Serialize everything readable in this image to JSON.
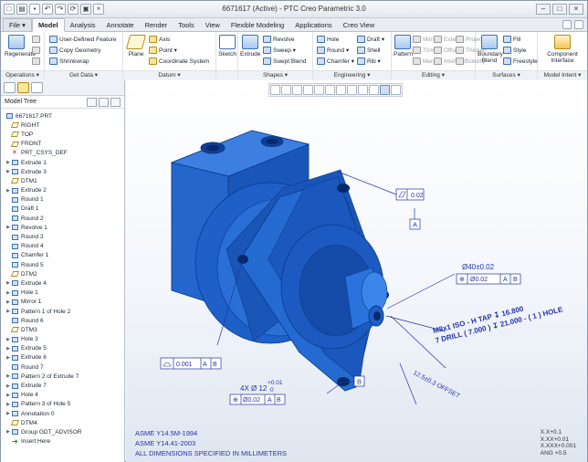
{
  "window": {
    "title": "6671617 (Active) - PTC Creo Parametric 3.0"
  },
  "tabs": [
    "File ▾",
    "Model",
    "Analysis",
    "Annotate",
    "Render",
    "Tools",
    "View",
    "Flexible Modeling",
    "Applications",
    "Creo View"
  ],
  "active_tab": "Model",
  "ribbon": {
    "operations": {
      "label": "Operations ▾",
      "regenerate": "Regenerate"
    },
    "get_data": {
      "label": "Get Data ▾",
      "udf": "User-Defined Feature",
      "copy_geometry": "Copy Geometry",
      "shrinkwrap": "Shrinkwrap"
    },
    "datum": {
      "label": "Datum ▾",
      "plane": "Plane",
      "axis": "Axis",
      "point": "Point ▾",
      "csys": "Coordinate System"
    },
    "sketch": "Sketch",
    "shapes": {
      "label": "Shapes ▾",
      "extrude": "Extrude",
      "revolve": "Revolve",
      "sweep": "Sweep ▾",
      "swept_blend": "Swept Blend"
    },
    "engineering": {
      "label": "Engineering ▾",
      "hole": "Hole",
      "round": "Round ▾",
      "chamfer": "Chamfer ▾",
      "draft": "Draft ▾",
      "shell": "Shell",
      "rib": "Rib ▾"
    },
    "editing": {
      "label": "Editing ▾",
      "pattern": "Pattern",
      "mirror": "Mirror",
      "trim": "Trim",
      "merge": "Merge",
      "extend": "Extend",
      "offset": "Offset",
      "intersect": "Intersect",
      "project": "Project",
      "thicken": "Thicken",
      "solidify": "Solidify"
    },
    "surfaces": {
      "label": "Surfaces ▾",
      "fill": "Fill",
      "style": "Style",
      "freestyle": "Freestyle",
      "boundary_blend": "Boundary Blend"
    },
    "model_intent": {
      "label": "Model Intent ▾",
      "component_interface": "Component Interface"
    }
  },
  "model_tree": {
    "title": "Model Tree",
    "items": [
      {
        "label": "6671617.PRT",
        "icon": "part-icon",
        "expandable": false
      },
      {
        "label": "RIGHT",
        "icon": "plane-icon",
        "expandable": false
      },
      {
        "label": "TOP",
        "icon": "plane-icon",
        "expandable": false
      },
      {
        "label": "FRONT",
        "icon": "plane-icon",
        "expandable": false
      },
      {
        "label": "PRT_CSYS_DEF",
        "icon": "csys-icon",
        "expandable": false
      },
      {
        "label": "Extrude 1",
        "icon": "feature-icon",
        "expandable": true
      },
      {
        "label": "Extrude 3",
        "icon": "feature-icon",
        "expandable": true
      },
      {
        "label": "DTM1",
        "icon": "plane-icon",
        "expandable": false
      },
      {
        "label": "Extrude 2",
        "icon": "feature-icon",
        "expandable": true
      },
      {
        "label": "Round 1",
        "icon": "feature-icon",
        "expandable": false
      },
      {
        "label": "Draft 1",
        "icon": "feature-icon",
        "expandable": false
      },
      {
        "label": "Round 2",
        "icon": "feature-icon",
        "expandable": false
      },
      {
        "label": "Revolve 1",
        "icon": "feature-icon",
        "expandable": true
      },
      {
        "label": "Round 3",
        "icon": "feature-icon",
        "expandable": false
      },
      {
        "label": "Round 4",
        "icon": "feature-icon",
        "expandable": false
      },
      {
        "label": "Chamfer 1",
        "icon": "feature-icon",
        "expandable": false
      },
      {
        "label": "Round 5",
        "icon": "feature-icon",
        "expandable": false
      },
      {
        "label": "DTM2",
        "icon": "plane-icon",
        "expandable": false
      },
      {
        "label": "Extrude 4",
        "icon": "feature-icon",
        "expandable": true
      },
      {
        "label": "Hole 1",
        "icon": "feature-icon",
        "expandable": true
      },
      {
        "label": "Mirror 1",
        "icon": "feature-icon",
        "expandable": true
      },
      {
        "label": "Pattern 1 of Hole 2",
        "icon": "feature-icon",
        "expandable": true
      },
      {
        "label": "Round 6",
        "icon": "feature-icon",
        "expandable": false
      },
      {
        "label": "DTM3",
        "icon": "plane-icon",
        "expandable": false
      },
      {
        "label": "Hole 3",
        "icon": "feature-icon",
        "expandable": true
      },
      {
        "label": "Extrude 5",
        "icon": "feature-icon",
        "expandable": true
      },
      {
        "label": "Extrude 6",
        "icon": "feature-icon",
        "expandable": true
      },
      {
        "label": "Round 7",
        "icon": "feature-icon",
        "expandable": false
      },
      {
        "label": "Pattern 2 of Extrude 7",
        "icon": "feature-icon",
        "expandable": true
      },
      {
        "label": "Extrude 7",
        "icon": "feature-icon",
        "expandable": true
      },
      {
        "label": "Hole 4",
        "icon": "feature-icon",
        "expandable": true
      },
      {
        "label": "Pattern 3 of Hole 5",
        "icon": "feature-icon",
        "expandable": true
      },
      {
        "label": "Annotation 0",
        "icon": "feature-icon",
        "expandable": true
      },
      {
        "label": "DTM4",
        "icon": "plane-icon",
        "expandable": false
      },
      {
        "label": "Group GDT_ADVISOR",
        "icon": "feature-icon",
        "expandable": true
      },
      {
        "label": "Insert Here",
        "icon": "insert-arrow-icon",
        "expandable": false
      }
    ]
  },
  "annotations": {
    "flatness": "0.02",
    "datum_a": "A",
    "datum_b": "B",
    "bore_dim": "Ø40±0.02",
    "position_tol": "Ø0.02",
    "tap_line1": "M8x1 ISO - H TAP ↧ 16.800",
    "tap_line2": "7 DRILL ( 7.000 ) ↧ 21.000 - ( 1 ) HOLE",
    "profile_tol": "0.001",
    "hole_dim": "4X Ø 12",
    "hole_tol_plus": "+0.01",
    "hole_tol_minus": "0",
    "hole_pos_tol": "Ø0.02",
    "offset_dim": "12.5±0.3 OFFSET"
  },
  "notes": [
    "ASME Y14.5M-1994",
    "ASME Y14.41-2003",
    "ALL DIMENSIONS SPECIFIED IN MILLIMETERS"
  ],
  "tolerances": [
    "X.X+0.1",
    "X.XX+0.01",
    "X.XXX+0.001",
    "ANG +0.5"
  ],
  "colors": {
    "model_blue": "#1a5fc8",
    "annotation_blue": "#2433a8"
  }
}
